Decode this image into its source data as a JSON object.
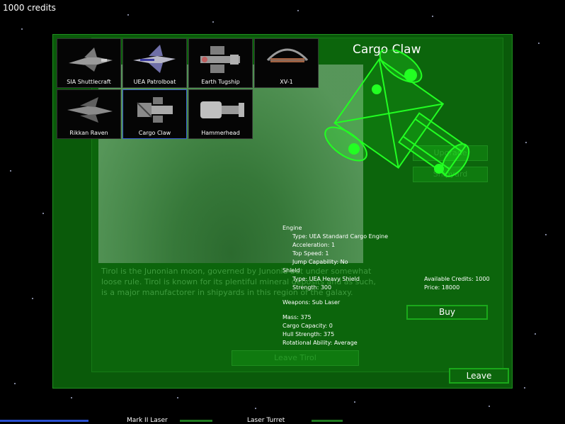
{
  "hud": {
    "credits": "1000 credits"
  },
  "ships": [
    {
      "name": "SIA Shuttlecraft",
      "icon": "shuttlecraft-icon",
      "selected": false
    },
    {
      "name": "UEA Patrolboat",
      "icon": "patrolboat-icon",
      "selected": false
    },
    {
      "name": "Earth Tugship",
      "icon": "tugship-icon",
      "selected": false
    },
    {
      "name": "XV-1",
      "icon": "xv1-icon",
      "selected": false
    },
    {
      "name": "Rikkan Raven",
      "icon": "raven-icon",
      "selected": false
    },
    {
      "name": "Cargo Claw",
      "icon": "cargo-claw-icon",
      "selected": true
    },
    {
      "name": "Hammerhead",
      "icon": "hammerhead-icon",
      "selected": false
    }
  ],
  "selected_ship": {
    "name": "Cargo Claw",
    "engine_heading": "Engine",
    "engine_type": "Type: UEA Standard Cargo Engine",
    "acceleration": "Acceleration: 1",
    "top_speed": "Top Speed: 1",
    "jump": "Jump Capability: No",
    "shield_heading": "Shield",
    "shield_type": "Type: UEA Heavy Shield",
    "shield_strength": "Strength: 300",
    "weapons": "Weapons: Sub Laser",
    "mass": "Mass: 375",
    "cargo": "Cargo Capacity: 0",
    "hull": "Hull Strength: 375",
    "rotation": "Rotational Ability: Average"
  },
  "purchase": {
    "available_credits": "Available Credits: 1000",
    "price": "Price: 18000",
    "buy_label": "Buy"
  },
  "background_station": {
    "description": "Tirol is the Junonian moon, governed by Junonia but under somewhat loose rule. Tirol is known for its plentiful mineral deposits and as such, is a major manufactorer in shipyards in this region of the galaxy.",
    "btn_upgrade": "Upgrade",
    "btn_shipyard": "Shipyard",
    "btn_leave_tirol": "Leave Tirol"
  },
  "leave_label": "Leave",
  "bottom_bar": {
    "weapon1": "Mark II Laser",
    "weapon2": "Laser Turret"
  },
  "colors": {
    "panel": "#0a5a0a",
    "wireframe": "#22ff22",
    "button_border": "#1aa81a"
  }
}
